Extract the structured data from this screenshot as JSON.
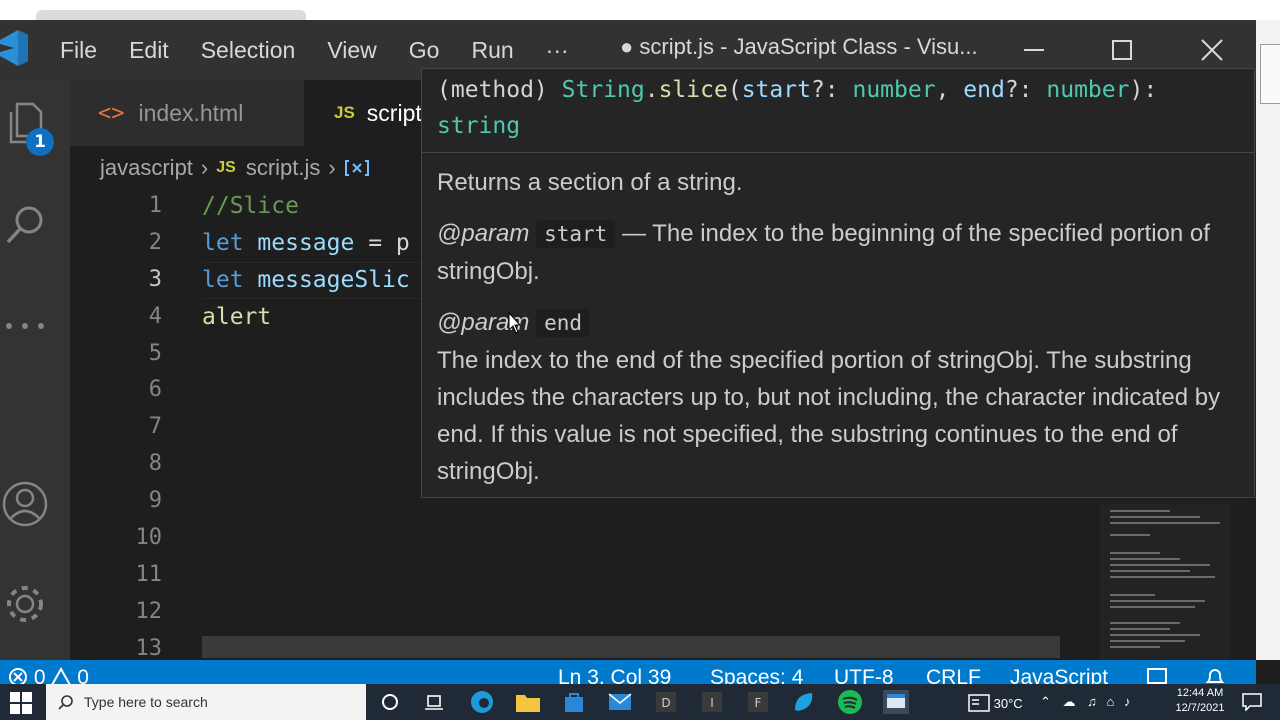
{
  "window": {
    "title": "● script.js - JavaScript Class - Visu...",
    "menu": [
      "File",
      "Edit",
      "Selection",
      "View",
      "Go",
      "Run",
      "···"
    ]
  },
  "activity": {
    "badge": "1"
  },
  "tabs": [
    {
      "label": "index.html",
      "icon": "html-icon"
    },
    {
      "label": "script",
      "icon": "js-icon"
    }
  ],
  "breadcrumb": {
    "folder": "javascript",
    "file": "script.js",
    "icon": "JS"
  },
  "editor": {
    "line_numbers": [
      "1",
      "2",
      "3",
      "4",
      "5",
      "6",
      "7",
      "8",
      "9",
      "10",
      "11",
      "12",
      "13"
    ],
    "lines": {
      "l1": {
        "comment": "//Slice"
      },
      "l2": {
        "kw": "let",
        "name": "message",
        "rest": " = p"
      },
      "l3": {
        "kw": "let",
        "name": "messageSlic"
      },
      "l4": {
        "fn": "alert"
      }
    }
  },
  "hover": {
    "sig": {
      "p1": "(method) ",
      "type": "String",
      "dot": ".",
      "fn": "slice",
      "p2": "(",
      "a1": "start",
      "p3": "?: ",
      "t1": "number",
      "p4": ", ",
      "a2": "end",
      "p5": "?: ",
      "t2": "number",
      "p6": "):",
      "ret": "string"
    },
    "summary": "Returns a section of a string.",
    "param1": {
      "tag": "@param",
      "name": "start",
      "desc": " — The index to the beginning of the specified portion of stringObj."
    },
    "param2": {
      "tag": "@param",
      "name": "end",
      "desc": "The index to the end of the specified portion of stringObj. The substring includes the characters up to, but not including, the character indicated by end. If this value is not specified, the substring continues to the end of stringObj."
    }
  },
  "status": {
    "errors": "0",
    "warnings": "0",
    "position": "Ln 3, Col 39",
    "spaces": "Spaces: 4",
    "encoding": "UTF-8",
    "eol": "CRLF",
    "language": "JavaScript"
  },
  "taskbar": {
    "search_placeholder": "Type here to search",
    "weather": "30°C",
    "time": "12:44 AM",
    "date": "12/7/2021"
  },
  "colors": {
    "accent": "#007acc",
    "badge": "#0e70c0",
    "taskbar": "#1f2a36"
  }
}
